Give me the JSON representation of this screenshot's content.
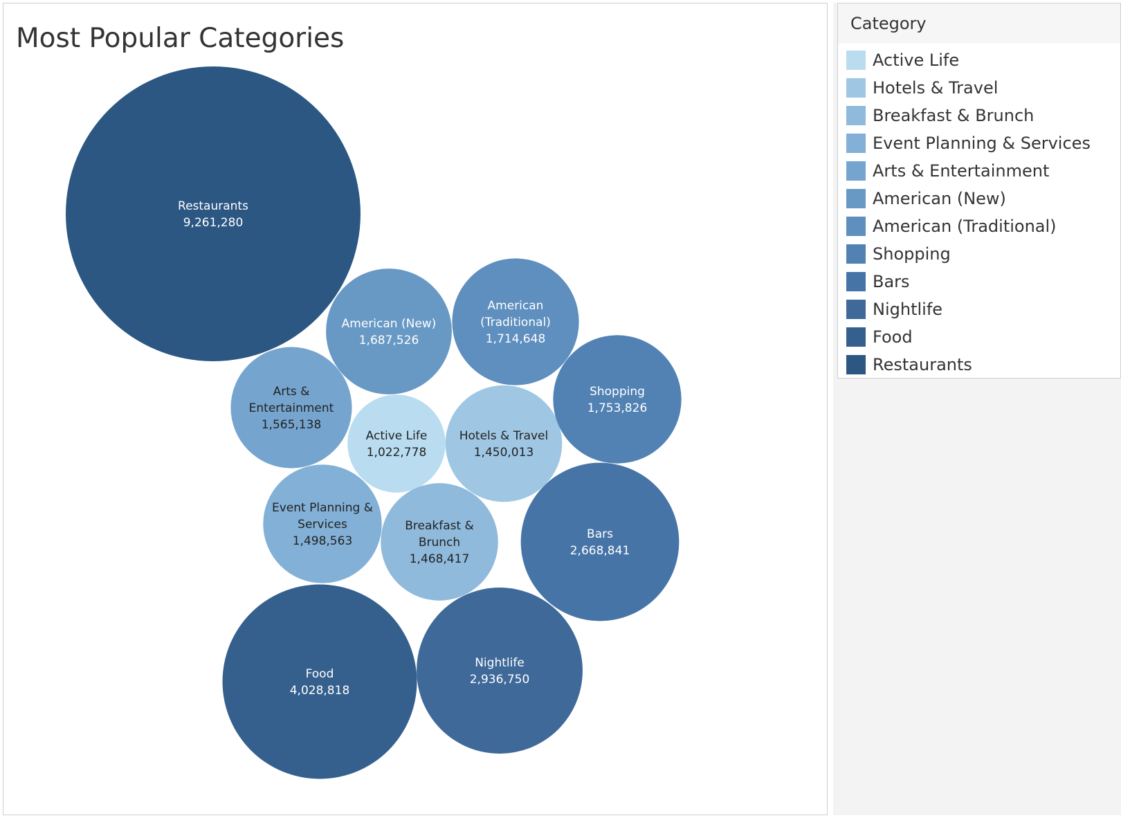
{
  "chart_data": {
    "type": "bubble",
    "title": "Most Popular Categories",
    "legend_title": "Category",
    "legend_position": "right",
    "categories": [
      {
        "name": "Active Life",
        "label_lines": [
          "Active Life"
        ],
        "value": 1022778,
        "value_text": "1,022,778",
        "color": "#b9dcf0",
        "text_color": "#222222"
      },
      {
        "name": "Hotels & Travel",
        "label_lines": [
          "Hotels & Travel"
        ],
        "value": 1450013,
        "value_text": "1,450,013",
        "color": "#9fc7e4",
        "text_color": "#222222"
      },
      {
        "name": "Breakfast & Brunch",
        "label_lines": [
          "Breakfast &",
          "Brunch"
        ],
        "value": 1468417,
        "value_text": "1,468,417",
        "color": "#8fbadc",
        "text_color": "#222222"
      },
      {
        "name": "Event Planning & Services",
        "label_lines": [
          "Event Planning &",
          "Services"
        ],
        "value": 1498563,
        "value_text": "1,498,563",
        "color": "#82b0d6",
        "text_color": "#222222"
      },
      {
        "name": "Arts & Entertainment",
        "label_lines": [
          "Arts &",
          "Entertainment"
        ],
        "value": 1565138,
        "value_text": "1,565,138",
        "color": "#75a5cf",
        "text_color": "#222222"
      },
      {
        "name": "American (New)",
        "label_lines": [
          "American (New)"
        ],
        "value": 1687526,
        "value_text": "1,687,526",
        "color": "#6899c5",
        "text_color": "#ffffff"
      },
      {
        "name": "American (Traditional)",
        "label_lines": [
          "American",
          "(Traditional)"
        ],
        "value": 1714648,
        "value_text": "1,714,648",
        "color": "#5e8fbe",
        "text_color": "#ffffff"
      },
      {
        "name": "Shopping",
        "label_lines": [
          "Shopping"
        ],
        "value": 1753826,
        "value_text": "1,753,826",
        "color": "#5282b4",
        "text_color": "#ffffff"
      },
      {
        "name": "Bars",
        "label_lines": [
          "Bars"
        ],
        "value": 2668841,
        "value_text": "2,668,841",
        "color": "#4774a6",
        "text_color": "#ffffff"
      },
      {
        "name": "Nightlife",
        "label_lines": [
          "Nightlife"
        ],
        "value": 2936750,
        "value_text": "2,936,750",
        "color": "#3e6999",
        "text_color": "#ffffff"
      },
      {
        "name": "Food",
        "label_lines": [
          "Food"
        ],
        "value": 4028818,
        "value_text": "4,028,818",
        "color": "#35608d",
        "text_color": "#ffffff"
      },
      {
        "name": "Restaurants",
        "label_lines": [
          "Restaurants"
        ],
        "value": 9261280,
        "value_text": "9,261,280",
        "color": "#2c5782",
        "text_color": "#ffffff"
      }
    ]
  }
}
